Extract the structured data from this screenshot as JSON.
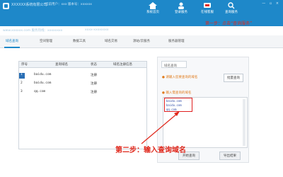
{
  "header": {
    "app_title": "XXXXXX系统有限公司",
    "app_info": "当前用户：xxx   版本号：xxxxxx",
    "sub_info": "www.xxxxxx.com  服务热线：xxxxxxxx",
    "sub_info2": "xxxx-xxxxxxxx",
    "window_controls": "— ▫ ×",
    "banner": "第一步：点击“查询服务”",
    "toolbar": [
      {
        "label": "系统首页",
        "icon": "home-icon"
      },
      {
        "label": "登录服务",
        "icon": "user-icon"
      },
      {
        "label": "在线客服",
        "icon": "service-icon"
      },
      {
        "label": "查询服务",
        "icon": "search-icon"
      }
    ]
  },
  "tabs": [
    {
      "label": "域名查询",
      "active": true
    },
    {
      "label": "空间管理",
      "active": false
    },
    {
      "label": "数据工具",
      "active": false
    },
    {
      "label": "域名交易",
      "active": false
    },
    {
      "label": "源站/云服务",
      "active": false
    },
    {
      "label": "服务器管理",
      "active": false
    }
  ],
  "table": {
    "columns": [
      "序号",
      "查询域名",
      "状态",
      "域名注册信息"
    ],
    "rows": [
      {
        "num": "1",
        "domain": "baidu.com",
        "status": "注册",
        "info": ""
      },
      {
        "num": "2",
        "domain": "baidu.com",
        "status": "注册",
        "info": ""
      },
      {
        "num": "3",
        "domain": "qq.com",
        "status": "注册",
        "info": ""
      }
    ]
  },
  "right_panel": {
    "title": "域名查询",
    "hint1": "● 请输入您要查询的域名",
    "hint2": "● 输入需查询的域名",
    "small_button": "批量查询",
    "domains": [
      "baidu.com",
      "baidu.com",
      "qq.com"
    ],
    "btn_query": "开始查询",
    "btn_export": "导出结果"
  },
  "annotation": {
    "step_text": "第二步：输入查询域名"
  },
  "colors": {
    "header_blue": "#1e88c9",
    "annotation_red": "#e0281c",
    "hint_orange": "#e07a1a"
  }
}
